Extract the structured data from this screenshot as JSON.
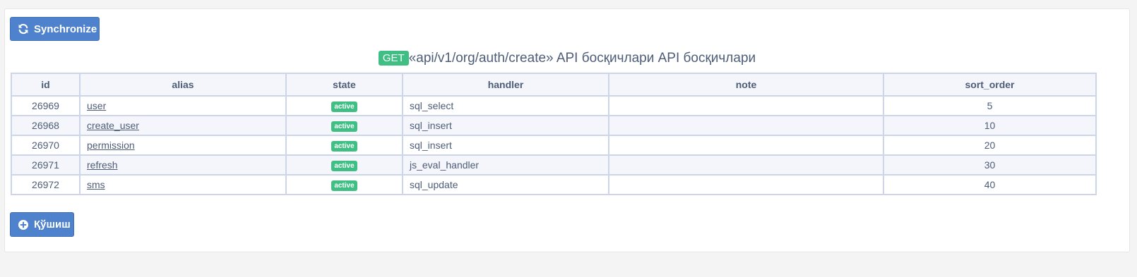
{
  "toolbar": {
    "sync_label": "Synchronize",
    "sync_icon": "refresh-icon",
    "add_label": "Қўшиш",
    "add_icon": "plus-circle-icon"
  },
  "title": {
    "method": "GET",
    "text": "«api/v1/org/auth/create» API босқичлари API босқичлари"
  },
  "table": {
    "columns": [
      "id",
      "alias",
      "state",
      "handler",
      "note",
      "sort_order"
    ],
    "rows": [
      {
        "id": "26969",
        "alias": "user",
        "state": "active",
        "handler": "sql_select",
        "note": "",
        "sort_order": "5"
      },
      {
        "id": "26968",
        "alias": "create_user",
        "state": "active",
        "handler": "sql_insert",
        "note": "",
        "sort_order": "10"
      },
      {
        "id": "26970",
        "alias": "permission",
        "state": "active",
        "handler": "sql_insert",
        "note": "",
        "sort_order": "20"
      },
      {
        "id": "26971",
        "alias": "refresh",
        "state": "active",
        "handler": "js_eval_handler",
        "note": "",
        "sort_order": "30"
      },
      {
        "id": "26972",
        "alias": "sms",
        "state": "active",
        "handler": "sql_update",
        "note": "",
        "sort_order": "40"
      }
    ]
  },
  "colors": {
    "primary_button": "#4f82cc",
    "success_badge": "#3fbf83",
    "text": "#4d5d77",
    "table_border": "#cdd6e8",
    "row_alt": "#f4f6fb"
  }
}
